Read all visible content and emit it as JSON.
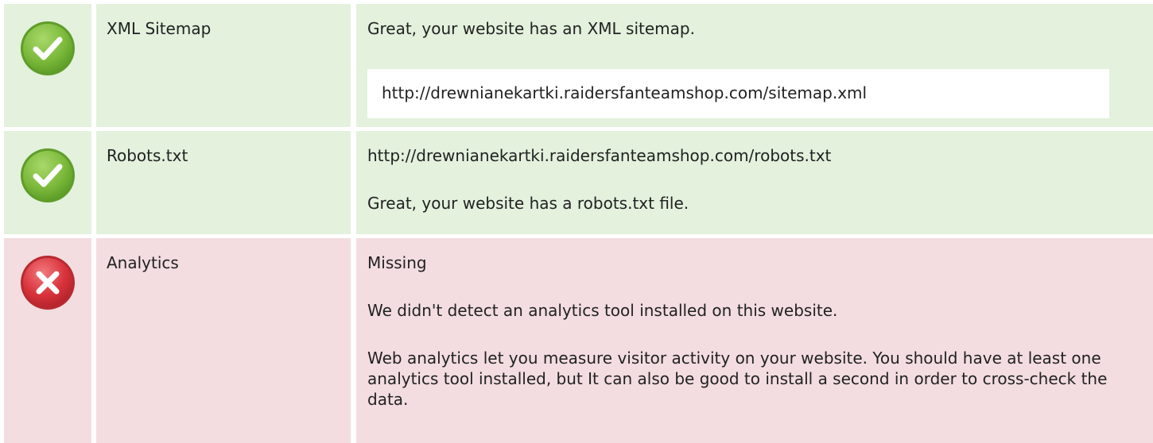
{
  "colors": {
    "pass_background": "#e3f1dd",
    "fail_background": "#f3dde0",
    "pass_icon": "#7dba3c",
    "fail_icon": "#d9333c"
  },
  "checks": [
    {
      "status_icon": "check-circle-icon",
      "label": "XML Sitemap",
      "message": "Great, your website has an XML sitemap.",
      "url": "http://drewnianekartki.raidersfanteamshop.com/sitemap.xml"
    },
    {
      "status_icon": "check-circle-icon",
      "label": "Robots.txt",
      "url": "http://drewnianekartki.raidersfanteamshop.com/robots.txt",
      "message": "Great, your website has a robots.txt file."
    },
    {
      "status_icon": "x-circle-icon",
      "label": "Analytics",
      "status": "Missing",
      "message": "We didn't detect an analytics tool installed on this website.",
      "advice": "Web analytics let you measure visitor activity on your website. You should have at least one analytics tool installed, but It can also be good to install a second in order to cross-check the data."
    }
  ]
}
